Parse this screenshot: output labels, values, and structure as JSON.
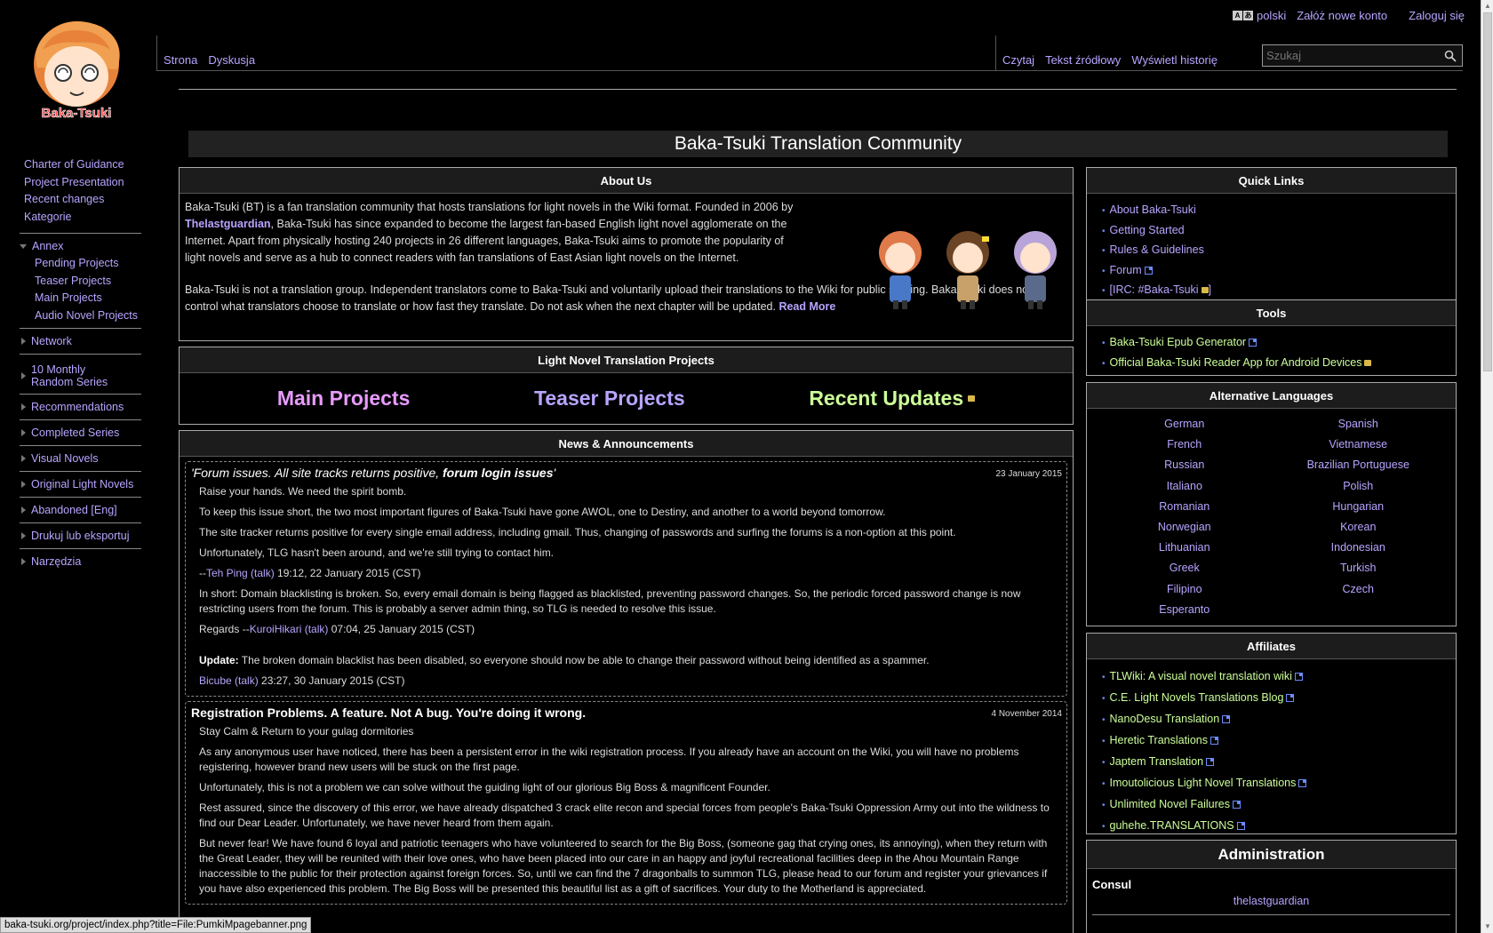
{
  "personal": {
    "lang": "polski",
    "create_account": "Załóż nowe konto",
    "login": "Zaloguj się"
  },
  "logo": {
    "text": "Baka-Tsuki"
  },
  "tabs": {
    "left": [
      "Strona",
      "Dyskusja"
    ],
    "right": [
      "Czytaj",
      "Tekst źródłowy",
      "Wyświetl historię"
    ]
  },
  "search": {
    "placeholder": "Szukaj"
  },
  "sidebar": {
    "top_links": [
      "Charter of Guidance",
      "Project Presentation",
      "Recent changes",
      "Kategorie"
    ],
    "annex": {
      "label": "Annex",
      "items": [
        "Pending Projects",
        "Teaser Projects",
        "Main Projects",
        "Audio Novel Projects"
      ]
    },
    "portals": [
      "Network",
      "10 Monthly Random Series",
      "Recommendations",
      "Completed Series",
      "Visual Novels",
      "Original Light Novels",
      "Abandoned [Eng]",
      "Drukuj lub eksportuj",
      "Narzędzia"
    ]
  },
  "banner": {
    "title": "Baka-Tsuki Translation Community"
  },
  "about": {
    "heading": "About Us",
    "p1_a": "Baka-Tsuki (BT) is a fan translation community that hosts translations for light novels in the Wiki format. Founded in 2006 by ",
    "p1_link": "Thelastguardian",
    "p1_b": ", Baka-Tsuki has since expanded to become the largest fan-based English light novel agglomerate on the Internet. Apart from physically hosting 240 projects in 26 different languages, Baka-Tsuki aims to promote the popularity of light novels and serve as a hub to connect readers with fan translations of East Asian light novels on the Internet.",
    "p2": "Baka-Tsuki is not a translation group. Independent translators come to Baka-Tsuki and voluntarily upload their translations to the Wiki for public sharing. Baka-Tsuki does not control what translators choose to translate or how fast they translate. Do not ask when the next chapter will be updated. ",
    "read_more": "Read More"
  },
  "ln_projects": {
    "heading": "Light Novel Translation Projects",
    "main": "Main Projects",
    "teaser": "Teaser Projects",
    "recent": "Recent Updates",
    "colors": {
      "main": "#e89bff",
      "teaser": "#b8a4ff",
      "recent": "#ccff99"
    }
  },
  "news": {
    "heading": "News & Announcements",
    "item1": {
      "title_a": "'Forum issues. All site tracks returns positive, ",
      "title_b": "forum login issues",
      "title_c": "'",
      "date": "23 January 2015",
      "p1": "Raise your hands. We need the spirit bomb.",
      "p2": "To keep this issue short, the two most important figures of Baka-Tsuki have gone AWOL, one to Destiny, and another to a world beyond tomorrow.",
      "p3": "The site tracker returns positive for every single email address, including gmail. Thus, changing of passwords and surfing the forums is a non-option at this point.",
      "p4": "Unfortunately, TLG hasn't been around, and we're still trying to contact him.",
      "sig1_prefix": "--",
      "sig1_user": "Teh Ping",
      "sig1_talk": "(talk)",
      "sig1_time": " 19:12, 22 January 2015 (CST)",
      "p5": "In short: Domain blacklisting is broken. So, every email domain is being flagged as blacklisted, preventing password changes. So, the periodic forced password change is now restricting users from the forum. This is probably a server admin thing, so TLG is needed to resolve this issue.",
      "sig2_prefix": "Regards --",
      "sig2_user": "KuroiHikari",
      "sig2_talk": "(talk)",
      "sig2_time": " 07:04, 25 January 2015 (CST)",
      "upd_label": "Update:",
      "upd_text": " The broken domain blacklist has been disabled, so everyone should now be able to change their password without being identified as a spammer.",
      "sig3_user": "Bicube",
      "sig3_talk": "(talk)",
      "sig3_time": " 23:27, 30 January 2015 (CST)"
    },
    "item2": {
      "title": "Registration Problems. A feature. Not A bug. You're doing it wrong.",
      "date": "4 November 2014",
      "p1": "Stay Calm & Return to your gulag dormitories",
      "p2": "As any anonymous user have noticed, there has been a persistent error in the wiki registration process. If you already have an account on the Wiki, you will have no problems registering, however brand new users will be stuck on the first page.",
      "p3": "Unfortunately, this is not a problem we can solve without the guiding light of our glorious Big Boss & magnificent Founder.",
      "p4": "Rest assured, since the discovery of this error, we have already dispatched 3 crack elite recon and special forces from people's Baka-Tsuki Oppression Army out into the wildness to find our Dear Leader. Unfortunately, we have never heard from them again.",
      "p5": "But never fear! We have found 6 loyal and patriotic teenagers who have volunteered to search for the Big Boss, (someone gag that crying ones, its annoying), when they return with the Great Leader, they will be reunited with their love ones, who have been placed into our care in an happy and joyful recreational facilities deep in the Ahou Mountain Range inaccessible to the public for their protection against foreign forces. So, until we can find the 7 dragonballs to summon TLG, please head to our forum and register your grievances if you have also experienced this problem. The Big Boss will be presented this beautiful list as a gift of sacrifices. Your duty to the Motherland is appreciated."
    }
  },
  "quick_links": {
    "heading": "Quick Links",
    "items": [
      "About Baka-Tsuki",
      "Getting Started",
      "Rules & Guidelines",
      "Forum",
      "[IRC: #Baka-Tsuki"
    ],
    "irc_close": "]"
  },
  "tools": {
    "heading": "Tools",
    "items": [
      "Baka-Tsuki Epub Generator",
      "Official Baka-Tsuki Reader App for Android Devices"
    ]
  },
  "alt_langs": {
    "heading": "Alternative Languages",
    "items": [
      "German",
      "Spanish",
      "French",
      "Vietnamese",
      "Russian",
      "Brazilian Portuguese",
      "Italiano",
      "Polish",
      "Romanian",
      "Hungarian",
      "Norwegian",
      "Korean",
      "Lithuanian",
      "Indonesian",
      "Greek",
      "Turkish",
      "Filipino",
      "Czech",
      "Esperanto"
    ]
  },
  "affiliates": {
    "heading": "Affiliates",
    "items": [
      "TLWiki: A visual novel translation wiki",
      "C.E. Light Novels Translations Blog",
      "NanoDesu Translation",
      "Heretic Translations",
      "Japtem Translation",
      "Imoutolicious Light Novel Translations",
      "Unlimited Novel Failures",
      "guhehe.TRANSLATIONS"
    ]
  },
  "admin": {
    "heading": "Administration",
    "consul": "Consul",
    "name": "thelastguardian"
  },
  "status_bar": {
    "url": "baka-tsuki.org/project/index.php?title=File:PumkiMpagebanner.png"
  }
}
